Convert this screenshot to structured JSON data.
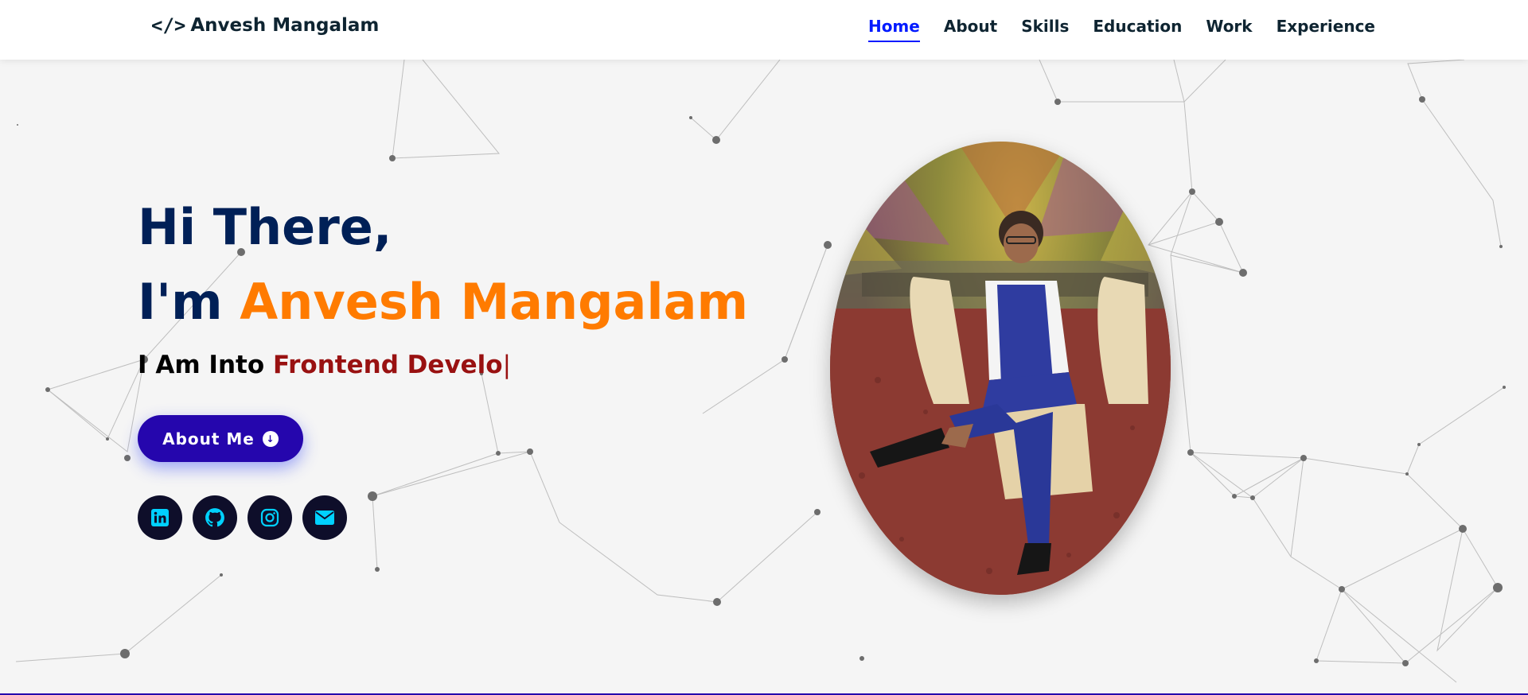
{
  "header": {
    "brand_icon": "</>",
    "brand_name": "Anvesh Mangalam",
    "nav": [
      {
        "label": "Home",
        "active": true
      },
      {
        "label": "About",
        "active": false
      },
      {
        "label": "Skills",
        "active": false
      },
      {
        "label": "Education",
        "active": false
      },
      {
        "label": "Work",
        "active": false
      },
      {
        "label": "Experience",
        "active": false
      }
    ]
  },
  "hero": {
    "greeting": "Hi There,",
    "intro_prefix": "I'm ",
    "name": "Anvesh Mangalam",
    "typing_prefix": "I Am Into ",
    "typing_role": "Frontend Develo",
    "cursor": "|",
    "button_label": "About Me",
    "button_icon": "arrow-circle-down-icon"
  },
  "socials": [
    {
      "name": "linkedin",
      "icon": "linkedin-icon"
    },
    {
      "name": "github",
      "icon": "github-icon"
    },
    {
      "name": "instagram",
      "icon": "instagram-icon"
    },
    {
      "name": "email",
      "icon": "envelope-icon"
    }
  ],
  "colors": {
    "accent": "#011aff",
    "name_orange": "#ff7b00",
    "heading_navy": "#002057",
    "role_red": "#991111",
    "button_bg": "#2506ad",
    "social_bg": "#0e0e2a",
    "social_icon": "#00d1ff"
  }
}
